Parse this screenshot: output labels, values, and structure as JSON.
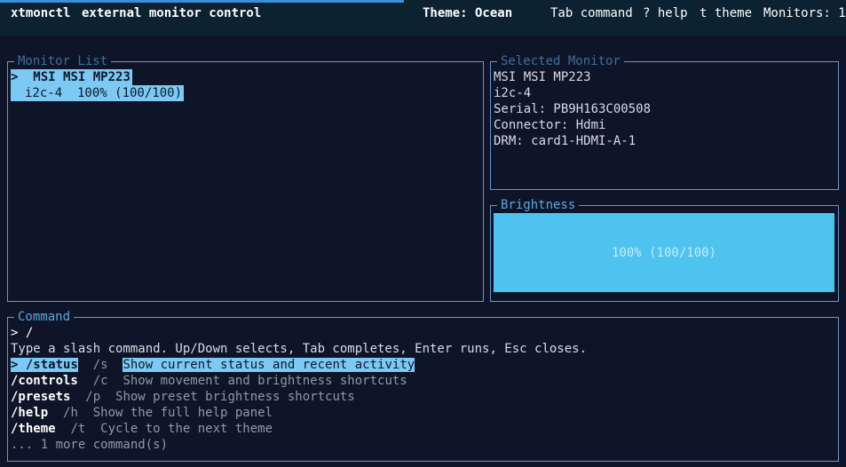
{
  "app": {
    "name": "xtmonctl",
    "subtitle": "external monitor control",
    "theme_label": "Theme: Ocean",
    "tab_hint": "Tab command",
    "help_hint": "? help",
    "theme_hint": "t theme",
    "monitors_label": "Monitors: 1"
  },
  "colors": {
    "background": "#0f1528",
    "border": "#6b97c9",
    "accent": "#4fc3ef",
    "highlight": "#7dc9f3"
  },
  "monitor_list": {
    "title": "Monitor List",
    "items": [
      {
        "marker": ">",
        "name": "MSI MSI MP223",
        "detail": "i2c-4  100% (100/100)"
      }
    ]
  },
  "selected_monitor": {
    "title": "Selected Monitor",
    "lines": [
      "MSI MSI MP223",
      "i2c-4",
      "Serial: PB9H163C00508",
      "Connector: Hdmi",
      "DRM: card1-HDMI-A-1"
    ]
  },
  "brightness": {
    "title": "Brightness",
    "value_percent": 100,
    "label": "100% (100/100)"
  },
  "command": {
    "title": "Command",
    "prompt": "> /",
    "hint": "Type a slash command. Up/Down selects, Tab completes, Enter runs, Esc closes.",
    "items": [
      {
        "prefix": "> ",
        "name": "/status",
        "alias": "/s",
        "desc": "Show current status and recent activity",
        "selected": true
      },
      {
        "prefix": "",
        "name": "/controls",
        "alias": "/c",
        "desc": "Show movement and brightness shortcuts",
        "selected": false
      },
      {
        "prefix": "",
        "name": "/presets",
        "alias": "/p",
        "desc": "Show preset brightness shortcuts",
        "selected": false
      },
      {
        "prefix": "",
        "name": "/help",
        "alias": "/h",
        "desc": "Show the full help panel",
        "selected": false
      },
      {
        "prefix": "",
        "name": "/theme",
        "alias": "/t",
        "desc": "Cycle to the next theme",
        "selected": false
      }
    ],
    "more": "... 1 more command(s)"
  }
}
